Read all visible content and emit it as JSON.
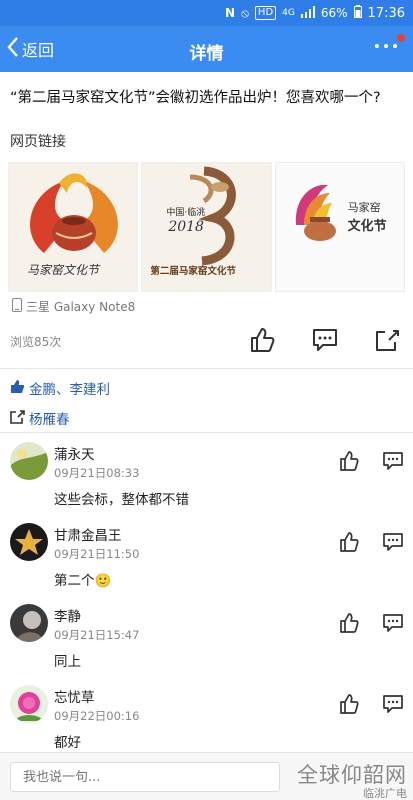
{
  "status": {
    "signal_label": "4G",
    "hd_badge": "HD",
    "battery": "66%",
    "time": "17:36"
  },
  "nav": {
    "back_label": "返回",
    "title": "详情"
  },
  "post": {
    "title": "“第二届马家窑文化节”会徽初选作品出炉！您喜欢哪一个?",
    "link_label": "网页链接",
    "device": "三星 Galaxy Note8",
    "views": "浏览85次",
    "logos": [
      {
        "caption": "马家窑文化节"
      },
      {
        "caption": "第二届马家窑文化节",
        "subcaption": "中国·临洮",
        "year": "2018"
      },
      {
        "caption": "马家窑",
        "subcaption": "文化节"
      }
    ]
  },
  "likes": {
    "names": "金鹏、李建利"
  },
  "shares": {
    "names": "杨雁春"
  },
  "comments": [
    {
      "name": "蒲永天",
      "time": "09月21日08:33",
      "text": "这些会标，整体都不错"
    },
    {
      "name": "甘肃金昌王",
      "time": "09月21日11:50",
      "text": "第二个🙂"
    },
    {
      "name": "李静",
      "time": "09月21日15:47",
      "text": "同上"
    },
    {
      "name": "忘忧草",
      "time": "09月22日00:16",
      "text": "都好"
    }
  ],
  "input": {
    "placeholder": "我也说一句..."
  },
  "watermark": {
    "main": "全球仰韶网",
    "small": "临洮广电"
  },
  "colors": {
    "nav_blue": "#3b8cf0",
    "link_blue": "#2a5db0",
    "notify_red": "#e8403a"
  }
}
